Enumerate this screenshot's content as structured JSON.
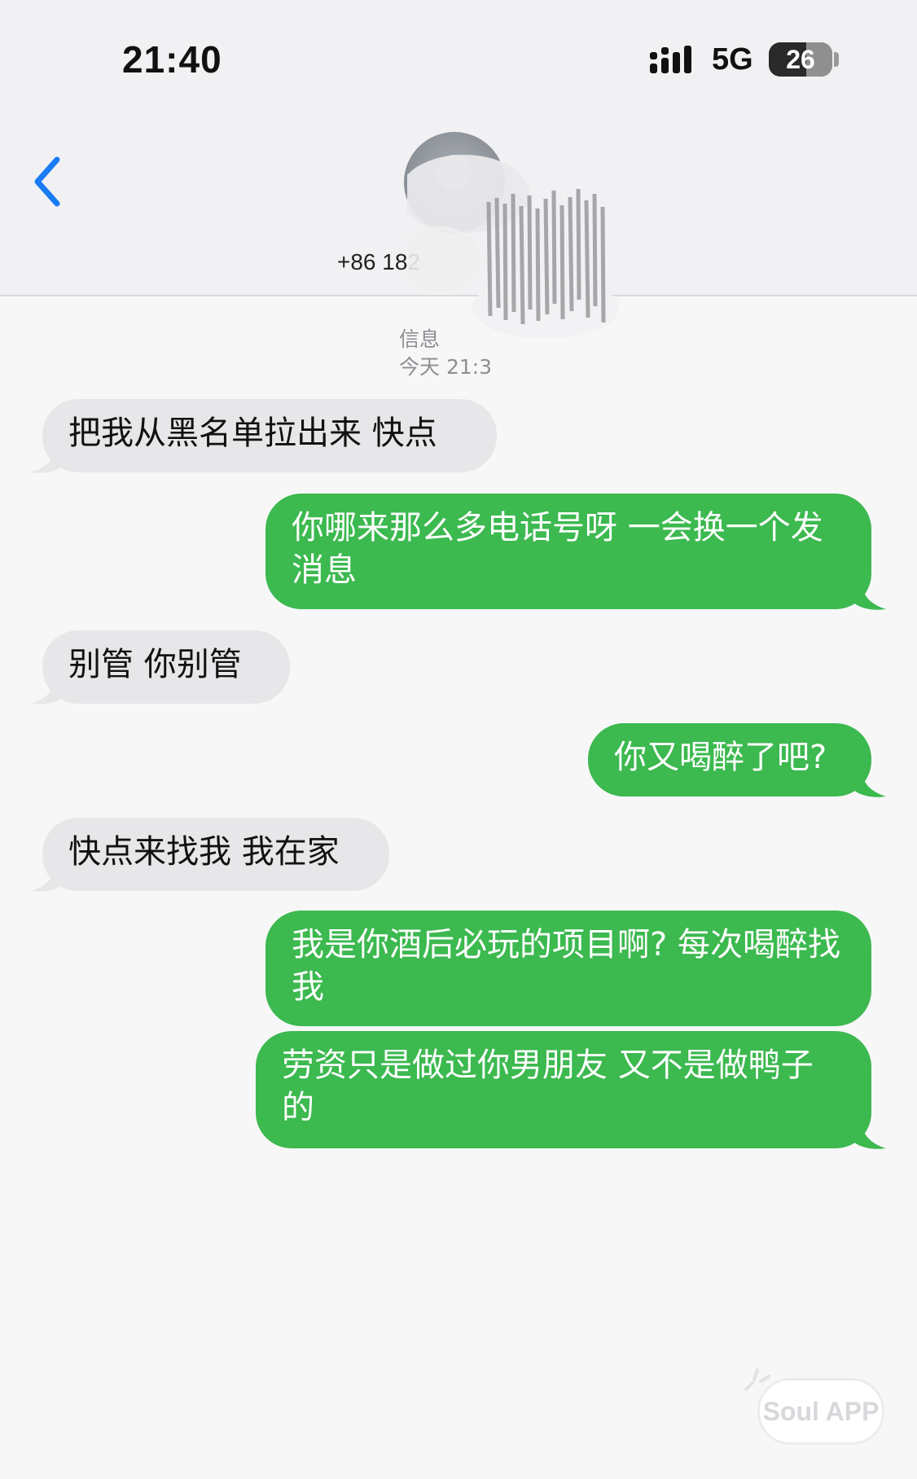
{
  "status_bar": {
    "time": "21:40",
    "network": "5G",
    "battery_level": "26",
    "battery_fraction": 0.26
  },
  "header": {
    "contact_number": "+86 182",
    "back_icon": "chevron-left-icon",
    "accent_color": "#1a7cf5"
  },
  "thread_meta": {
    "service": "信息",
    "timestamp": "今天 21:3"
  },
  "messages": [
    {
      "direction": "incoming",
      "text": "把我从黑名单拉出来 快点"
    },
    {
      "direction": "outgoing",
      "text": "你哪来那么多电话号呀  一会换一个发消息"
    },
    {
      "direction": "incoming",
      "text": "别管 你别管"
    },
    {
      "direction": "outgoing",
      "text": "你又喝醉了吧?"
    },
    {
      "direction": "incoming",
      "text": "快点来找我 我在家"
    },
    {
      "direction": "outgoing",
      "text": "我是你酒后必玩的项目啊?  每次喝醉找我"
    },
    {
      "direction": "outgoing",
      "text": "劳资只是做过你男朋友  又不是做鸭子的"
    }
  ],
  "colors": {
    "incoming_bubble": "#e7e7ea",
    "outgoing_bubble": "#3cb94f",
    "background": "#f7f7f8"
  },
  "watermark": {
    "text": "Soul APP"
  }
}
